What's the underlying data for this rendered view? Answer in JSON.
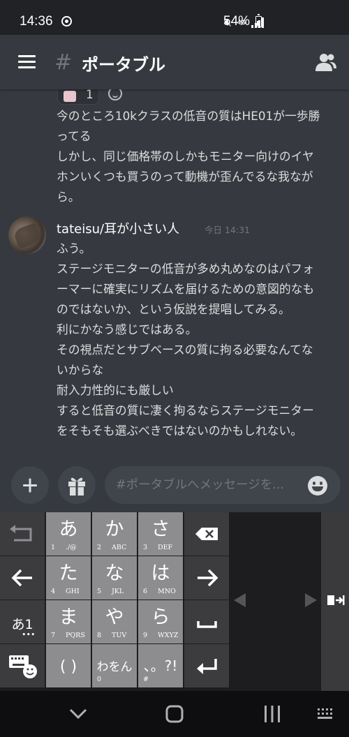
{
  "status_bar": {
    "time": "14:36",
    "network_label": "4G",
    "battery": "54%"
  },
  "header": {
    "hash_symbol": "#",
    "channel_name": "ポータブル"
  },
  "reaction": {
    "count": "1"
  },
  "messages": [
    {
      "lines": [
        "今のところ10kクラスの低音の質はHE01が一歩勝",
        "ってる",
        "しかし、同じ価格帯のしかもモニター向けのイヤ",
        "ホンいくつも買うのって動機が歪んでるな我なが",
        "ら。"
      ]
    },
    {
      "author": "tateisu/耳が小さい人",
      "timestamp": "今日 14:31",
      "lines": [
        "ふう。",
        "ステージモニターの低音が多め丸めなのはパフォ",
        "ーマーに確実にリズムを届けるための意図的なも",
        "のではないか、という仮説を提唱してみる。",
        "利にかなう感じではある。",
        "その視点だとサブベースの質に拘る必要なんてな",
        "いからな",
        "耐入力性的にも厳しい",
        "すると低音の質に凄く拘るならステージモニター",
        "をそもそも選ぶべきではないのかもしれない。"
      ]
    }
  ],
  "composer": {
    "placeholder": "#ポータブルへメッセージを..."
  },
  "keyboard": {
    "keys": [
      {
        "main": "あ",
        "num": "1",
        "sub": "./@"
      },
      {
        "main": "か",
        "num": "2",
        "sub": "ABC"
      },
      {
        "main": "さ",
        "num": "3",
        "sub": "DEF"
      },
      {
        "main": "た",
        "num": "4",
        "sub": "GHI"
      },
      {
        "main": "な",
        "num": "5",
        "sub": "JKL"
      },
      {
        "main": "は",
        "num": "6",
        "sub": "MNO"
      },
      {
        "main": "ま",
        "num": "7",
        "sub": "PQRS"
      },
      {
        "main": "や",
        "num": "8",
        "sub": "TUV"
      },
      {
        "main": "ら",
        "num": "9",
        "sub": "WXYZ"
      },
      {
        "main": "( )",
        "num": "",
        "sub": ""
      },
      {
        "main": "わをん",
        "num": "0",
        "sub": ""
      },
      {
        "main": "、。?!",
        "num": "#",
        "sub": ""
      }
    ],
    "mode_key": {
      "main": "あ1",
      "sub": "•••"
    }
  }
}
